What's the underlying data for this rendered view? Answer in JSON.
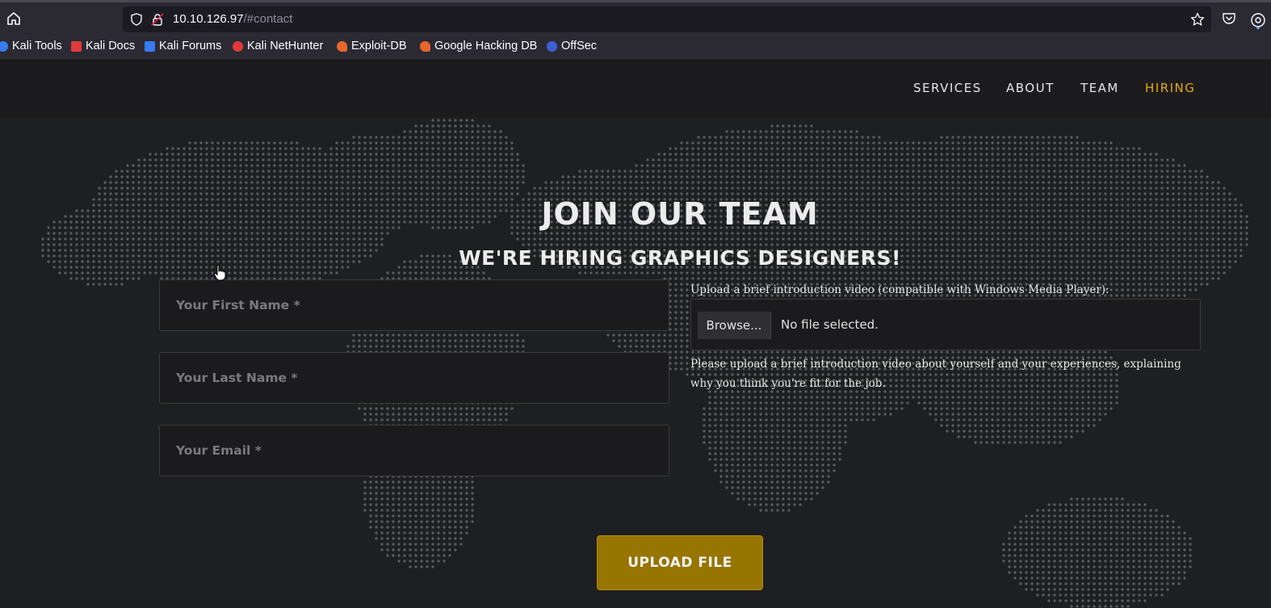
{
  "browser": {
    "url_host": "10.10.126.97",
    "url_path": "/#contact"
  },
  "bookmarks": [
    {
      "label": "Kali Tools",
      "icon": "kali-tools-icon",
      "color": "#367bf0"
    },
    {
      "label": "Kali Docs",
      "icon": "kali-docs-icon",
      "color": "#e03a3a"
    },
    {
      "label": "Kali Forums",
      "icon": "kali-forums-icon",
      "color": "#367bf0"
    },
    {
      "label": "Kali NetHunter",
      "icon": "kali-nethunter-icon",
      "color": "#e03a3a"
    },
    {
      "label": "Exploit-DB",
      "icon": "exploit-db-icon",
      "color": "#e8662c"
    },
    {
      "label": "Google Hacking DB",
      "icon": "ghdb-icon",
      "color": "#e8662c"
    },
    {
      "label": "OffSec",
      "icon": "offsec-icon",
      "color": "#3f5fd4"
    }
  ],
  "nav": {
    "services": "SERVICES",
    "about": "ABOUT",
    "team": "TEAM",
    "hiring": "HIRING",
    "active_color": "#e6a817"
  },
  "hero": {
    "title": "JOIN OUR TEAM",
    "subtitle": "WE'RE HIRING GRAPHICS DESIGNERS!"
  },
  "form": {
    "first_name_placeholder": "Your First Name *",
    "last_name_placeholder": "Your Last Name *",
    "email_placeholder": "Your Email *",
    "upload_label": "Upload a brief introduction video (compatible with Windows Media Player):",
    "browse_label": "Browse...",
    "file_status": "No file selected.",
    "help_text": "Please upload a brief introduction video about yourself and your experiences, explaining why you think you're fit for the job.",
    "submit_label": "UPLOAD FILE",
    "submit_color": "#977501"
  }
}
